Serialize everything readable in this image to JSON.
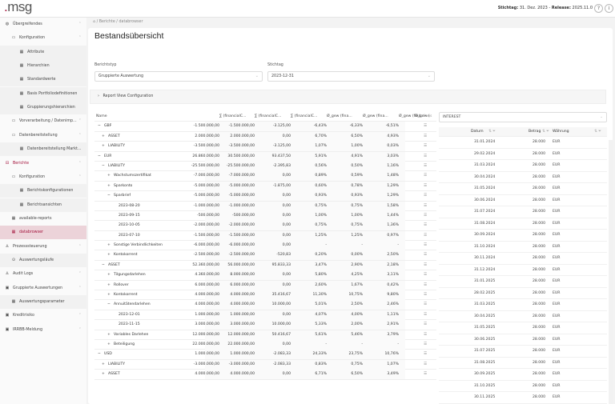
{
  "header": {
    "logo": ".msg",
    "stichtag_label": "Stichtag:",
    "stichtag": "31. Dez. 2023",
    "sep": "-",
    "release_label": "Release:",
    "release": "2025.11.0",
    "help": "?",
    "info": "i"
  },
  "sidebar": {
    "items": [
      {
        "label": "Übergreifendes",
        "icon": "globe-icon",
        "level": 0,
        "chev": "^"
      },
      {
        "label": "Konfiguration",
        "icon": "folder-icon",
        "level": 1,
        "chev": "^"
      },
      {
        "label": "Attribute",
        "icon": "table-icon",
        "level": 2
      },
      {
        "label": "Hierarchien",
        "icon": "table-icon",
        "level": 2
      },
      {
        "label": "Standardwerte",
        "icon": "table-icon",
        "level": 2
      },
      {
        "label": "Basis Portfoliodefinitionen",
        "icon": "table-icon",
        "level": 2
      },
      {
        "label": "Gruppierungshierarchien",
        "icon": "table-icon",
        "level": 2
      },
      {
        "label": "Vorverarbeitung / Datenimp...",
        "icon": "folder-icon",
        "level": 1,
        "chev": "v"
      },
      {
        "label": "Datenbereitstellung",
        "icon": "folder-icon",
        "level": 1,
        "chev": "^"
      },
      {
        "label": "Datenbereitstellung Markt...",
        "icon": "table-icon",
        "level": 2
      },
      {
        "label": "Berichte",
        "icon": "report-icon",
        "level": 0,
        "chev": "^",
        "red": true
      },
      {
        "label": "Konfiguration",
        "icon": "folder-icon",
        "level": 1,
        "chev": "^"
      },
      {
        "label": "Berichtskonfigurationen",
        "icon": "table-icon",
        "level": 2
      },
      {
        "label": "Berichtsansichten",
        "icon": "table-icon",
        "level": 2
      },
      {
        "label": "available-reports",
        "icon": "table-icon",
        "level": 1
      },
      {
        "label": "databrowser",
        "icon": "table-icon",
        "level": 1,
        "active": true
      },
      {
        "label": "Prozesssteuerung",
        "icon": "hierarchy-icon",
        "level": 0,
        "chev": "^"
      },
      {
        "label": "Auswertungsläufe",
        "icon": "play-icon",
        "level": 1
      },
      {
        "label": "Audit Logs",
        "icon": "hierarchy-icon",
        "level": 0,
        "chev": "v"
      },
      {
        "label": "Gruppierte Auswertungen",
        "icon": "window-icon",
        "level": 0,
        "chev": "^"
      },
      {
        "label": "Auswertungsparameter",
        "icon": "table-icon",
        "level": 1
      },
      {
        "label": "Kreditrisiko",
        "icon": "window-icon",
        "level": 0,
        "chev": "v"
      },
      {
        "label": "IRRBB-Meldung",
        "icon": "window-icon",
        "level": 0,
        "chev": "v"
      }
    ]
  },
  "breadcrumb": {
    "home": "⌂",
    "items": [
      "Berichte",
      "databrowser"
    ]
  },
  "page": {
    "title": "Bestandsübersicht"
  },
  "filters": {
    "berichtstyp_label": "Berichtstyp",
    "berichtstyp": "Gruppierte Auswertung",
    "stichtag_label": "Stichtag",
    "stichtag": "2023-12-31"
  },
  "report_view_config": "Report View Configuration",
  "table": {
    "columns": [
      "Name",
      "∑ (financialC...",
      "∑ (financialC...",
      "∑ (financialC...",
      "Ø_gew (fina...",
      "Ø_gew (fina...",
      "Ø_gew (fina...",
      "Ø_gew (",
      "Actions"
    ],
    "rows": [
      {
        "t": "−",
        "n": "GBP",
        "l": 0,
        "v": [
          "-1.500.000,00",
          "-1.500.000,00",
          "-3.125,00",
          "-6,43%",
          "-6,33%",
          "-6,51%"
        ]
      },
      {
        "t": "+",
        "n": "ASSET",
        "l": 1,
        "v": [
          "2.000.000,00",
          "2.000.000,00",
          "0,00",
          "6,70%",
          "6,50%",
          "4,93%"
        ]
      },
      {
        "t": "+",
        "n": "LIABILITY",
        "l": 1,
        "v": [
          "-3.500.000,00",
          "-3.500.000,00",
          "-3.125,00",
          "1,07%",
          "1,00%",
          "0,03%"
        ]
      },
      {
        "t": "−",
        "n": "EUR",
        "l": 0,
        "v": [
          "26.860.000,00",
          "30.500.000,00",
          "93.437,50",
          "5,91%",
          "4,91%",
          "3,03%"
        ]
      },
      {
        "t": "−",
        "n": "LIABILITY",
        "l": 1,
        "v": [
          "-25.500.000,00",
          "-25.500.000,00",
          "-2.395,83",
          "0,56%",
          "0,50%",
          "1,16%"
        ]
      },
      {
        "t": "+",
        "n": "Wachstumszertifikat",
        "l": 2,
        "v": [
          "-7.000.000,00",
          "-7.000.000,00",
          "0,00",
          "0,89%",
          "0,59%",
          "1,48%"
        ]
      },
      {
        "t": "+",
        "n": "Sparkonto",
        "l": 2,
        "v": [
          "-5.000.000,00",
          "-5.000.000,00",
          "-1.875,00",
          "0,60%",
          "0,78%",
          "1,29%"
        ]
      },
      {
        "t": "−",
        "n": "Sparbrief",
        "l": 2,
        "v": [
          "-5.000.000,00",
          "-5.000.000,00",
          "0,00",
          "0,93%",
          "0,93%",
          "1,29%"
        ]
      },
      {
        "t": "",
        "n": "2023-08-20",
        "l": 3,
        "v": [
          "-1.000.000,00",
          "-1.000.000,00",
          "0,00",
          "0,75%",
          "0,75%",
          "1,58%"
        ]
      },
      {
        "t": "",
        "n": "2023-09-15",
        "l": 3,
        "v": [
          "-500.000,00",
          "-500.000,00",
          "0,00",
          "1,00%",
          "1,00%",
          "1,44%"
        ]
      },
      {
        "t": "",
        "n": "2023-10-05",
        "l": 3,
        "v": [
          "-2.000.000,00",
          "-2.000.000,00",
          "0,00",
          "0,75%",
          "0,75%",
          "1,36%"
        ]
      },
      {
        "t": "",
        "n": "2023-07-10",
        "l": 3,
        "v": [
          "-1.500.000,00",
          "-1.500.000,00",
          "0,00",
          "1,25%",
          "1,25%",
          "0,97%"
        ]
      },
      {
        "t": "+",
        "n": "Sonstige Verbindlichkeiten",
        "l": 2,
        "v": [
          "-6.000.000,00",
          "-6.000.000,00",
          "0,00",
          "-",
          "-",
          "-"
        ]
      },
      {
        "t": "+",
        "n": "Kontokorrent",
        "l": 2,
        "v": [
          "-2.500.000,00",
          "-2.500.000,00",
          "-520,83",
          "0,20%",
          "0,00%",
          "2,50%"
        ]
      },
      {
        "t": "−",
        "n": "ASSET",
        "l": 1,
        "v": [
          "52.360.000,00",
          "56.000.000,00",
          "95.833,33",
          "3,47%",
          "2,90%",
          "2,18%"
        ]
      },
      {
        "t": "+",
        "n": "Tilgungsdarlehen",
        "l": 2,
        "v": [
          "4.360.000,00",
          "8.000.000,00",
          "0,00",
          "5,80%",
          "4,25%",
          "3,11%"
        ]
      },
      {
        "t": "+",
        "n": "Rollover",
        "l": 2,
        "v": [
          "6.000.000,00",
          "6.000.000,00",
          "0,00",
          "2,60%",
          "1,67%",
          "0,42%"
        ]
      },
      {
        "t": "+",
        "n": "Kontokorrent",
        "l": 2,
        "v": [
          "4.000.000,00",
          "4.000.000,00",
          "35.416,67",
          "11,30%",
          "10,75%",
          "9,80%"
        ]
      },
      {
        "t": "−",
        "n": "Annuitätendarlehen",
        "l": 2,
        "v": [
          "4.000.000,00",
          "4.000.000,00",
          "10.000,00",
          "5,01%",
          "2,50%",
          "2,46%"
        ]
      },
      {
        "t": "",
        "n": "2023-12-01",
        "l": 3,
        "v": [
          "1.000.000,00",
          "1.000.000,00",
          "0,00",
          "4,07%",
          "4,00%",
          "1,11%"
        ]
      },
      {
        "t": "",
        "n": "2023-11-15",
        "l": 3,
        "v": [
          "3.000.000,00",
          "3.000.000,00",
          "10.000,00",
          "5,33%",
          "2,00%",
          "2,91%"
        ]
      },
      {
        "t": "+",
        "n": "Variables Darlehen",
        "l": 2,
        "v": [
          "12.000.000,00",
          "12.000.000,00",
          "50.416,67",
          "5,61%",
          "5,46%",
          "3,79%"
        ]
      },
      {
        "t": "+",
        "n": "Beteiligung",
        "l": 2,
        "v": [
          "22.000.000,00",
          "22.000.000,00",
          "0,00",
          "-",
          "-",
          "-"
        ]
      },
      {
        "t": "−",
        "n": "USD",
        "l": 0,
        "v": [
          "1.000.000,00",
          "1.000.000,00",
          "-2.083,33",
          "24,33%",
          "23,75%",
          "10,76%"
        ]
      },
      {
        "t": "+",
        "n": "LIABILITY",
        "l": 1,
        "v": [
          "-3.000.000,00",
          "-3.000.000,00",
          "-2.083,33",
          "0,83%",
          "0,75%",
          "1,07%"
        ]
      },
      {
        "t": "+",
        "n": "ASSET",
        "l": 1,
        "v": [
          "4.000.000,00",
          "4.000.000,00",
          "0,00",
          "6,71%",
          "6,50%",
          "3,49%"
        ]
      }
    ]
  },
  "cashflow": {
    "type": "INTEREST",
    "columns": [
      "Datum",
      "Betrag",
      "Währung"
    ],
    "rows": [
      [
        "31.01.2024",
        "28.000",
        "EUR"
      ],
      [
        "29.02.2024",
        "28.000",
        "EUR"
      ],
      [
        "31.03.2024",
        "28.000",
        "EUR"
      ],
      [
        "30.04.2024",
        "28.000",
        "EUR"
      ],
      [
        "31.05.2024",
        "28.000",
        "EUR"
      ],
      [
        "30.06.2024",
        "28.000",
        "EUR"
      ],
      [
        "31.07.2024",
        "28.000",
        "EUR"
      ],
      [
        "31.08.2024",
        "28.000",
        "EUR"
      ],
      [
        "30.09.2024",
        "28.000",
        "EUR"
      ],
      [
        "31.10.2024",
        "28.000",
        "EUR"
      ],
      [
        "30.11.2024",
        "28.000",
        "EUR"
      ],
      [
        "31.12.2024",
        "28.000",
        "EUR"
      ],
      [
        "31.01.2025",
        "28.000",
        "EUR"
      ],
      [
        "28.02.2025",
        "28.000",
        "EUR"
      ],
      [
        "31.03.2025",
        "28.000",
        "EUR"
      ],
      [
        "30.04.2025",
        "28.000",
        "EUR"
      ],
      [
        "31.05.2025",
        "28.000",
        "EUR"
      ],
      [
        "30.06.2025",
        "28.000",
        "EUR"
      ],
      [
        "31.07.2025",
        "28.000",
        "EUR"
      ],
      [
        "31.08.2025",
        "28.000",
        "EUR"
      ],
      [
        "30.09.2025",
        "28.000",
        "EUR"
      ],
      [
        "31.10.2025",
        "28.000",
        "EUR"
      ],
      [
        "30.11.2025",
        "28.000",
        "EUR"
      ]
    ]
  },
  "colors": {
    "brand": "#a3123b",
    "active_bg": "#ecd3d9"
  }
}
